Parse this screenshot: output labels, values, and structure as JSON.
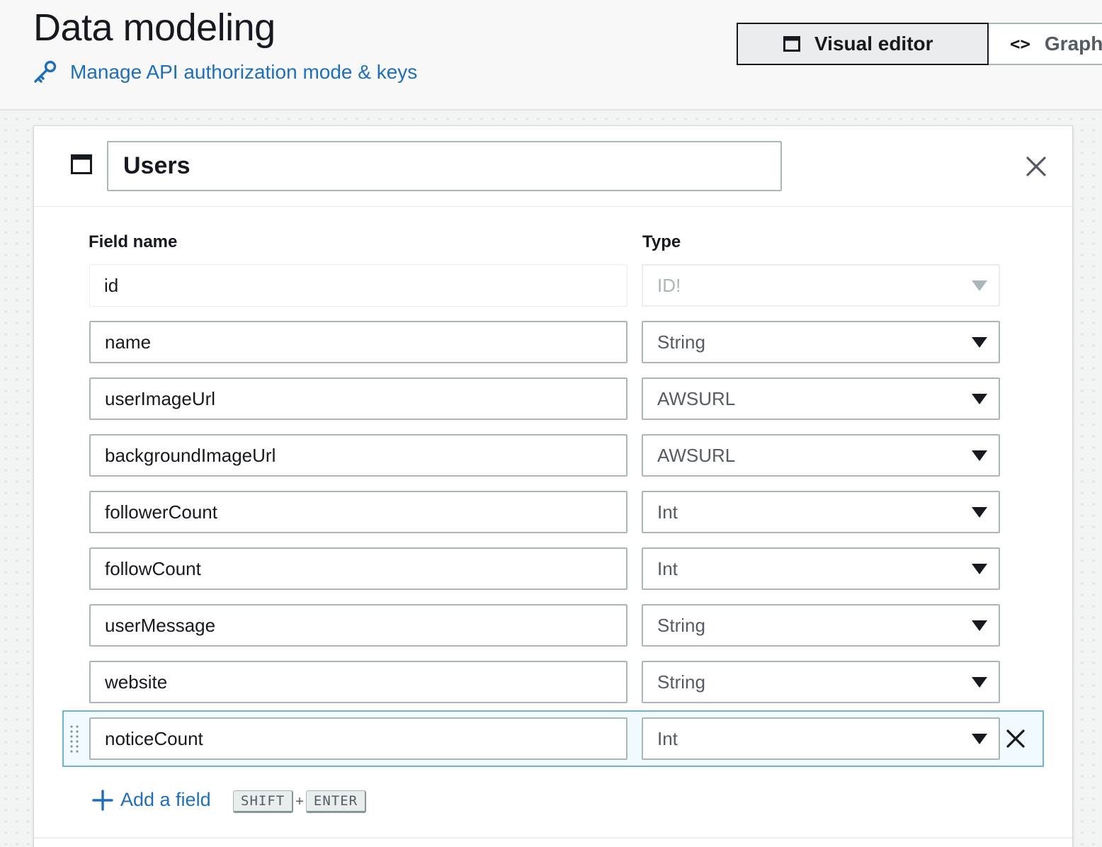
{
  "header": {
    "title": "Data modeling",
    "api_link": "Manage API authorization mode & keys",
    "views": [
      {
        "label": "Visual editor",
        "icon": "window-icon",
        "active": true
      },
      {
        "label": "GraphQL schema",
        "icon": "code-icon",
        "active": false
      }
    ]
  },
  "model": {
    "name": "Users",
    "icon": "window-icon",
    "columns": {
      "field_name": "Field name",
      "type": "Type"
    },
    "fields": [
      {
        "name": "id",
        "type": "ID!"
      },
      {
        "name": "name",
        "type": "String"
      },
      {
        "name": "userImageUrl",
        "type": "AWSURL"
      },
      {
        "name": "backgroundImageUrl",
        "type": "AWSURL"
      },
      {
        "name": "followerCount",
        "type": "Int"
      },
      {
        "name": "followCount",
        "type": "Int"
      },
      {
        "name": "userMessage",
        "type": "String"
      },
      {
        "name": "website",
        "type": "String"
      },
      {
        "name": "noticeCount",
        "type": "Int"
      }
    ],
    "add_field": {
      "label": "Add a field",
      "shortcut_keys": [
        "SHIFT",
        "ENTER"
      ],
      "shortcut_joiner": "+"
    }
  },
  "colors": {
    "link": "#1f6fb8",
    "selected_row_border": "#6fb3d2",
    "selected_row_bg": "#f1faff",
    "input_border": "#aab7b8"
  }
}
